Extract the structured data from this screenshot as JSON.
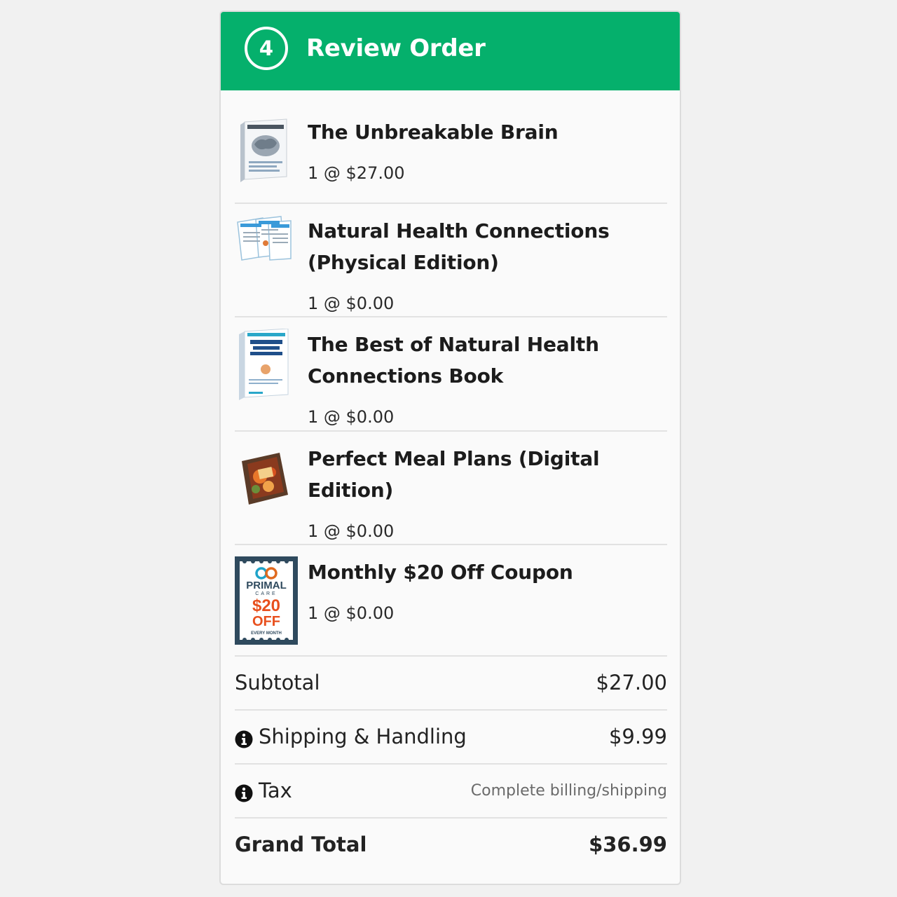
{
  "header": {
    "step": "4",
    "title": "Review Order",
    "bg_color": "#05b06c"
  },
  "items": [
    {
      "name": "The Unbreakable Brain",
      "qty": "1 @ $27.00",
      "thumb": "brain-book-icon"
    },
    {
      "name": "Natural Health Connections (Physical Edition)",
      "qty": "1 @ $0.00",
      "thumb": "newsletter-icon"
    },
    {
      "name": "The Best of Natural Health Connections Book",
      "qty": "1 @ $0.00",
      "thumb": "book-icon"
    },
    {
      "name": "Perfect Meal Plans (Digital Edition)",
      "qty": "1 @ $0.00",
      "thumb": "meal-plan-icon"
    },
    {
      "name": "Monthly $20 Off Coupon",
      "qty": "1 @ $0.00",
      "thumb": "coupon-icon"
    }
  ],
  "coupon_art": {
    "brand": "PRIMAL",
    "sub": "CARE",
    "amount": "$20",
    "off": "OFF",
    "footer": "EVERY MONTH"
  },
  "summary": {
    "subtotal_label": "Subtotal",
    "subtotal_value": "$27.00",
    "shipping_label": "Shipping & Handling",
    "shipping_value": "$9.99",
    "tax_label": "Tax",
    "tax_note": "Complete billing/shipping",
    "grand_total_label": "Grand Total",
    "grand_total_value": "$36.99"
  }
}
